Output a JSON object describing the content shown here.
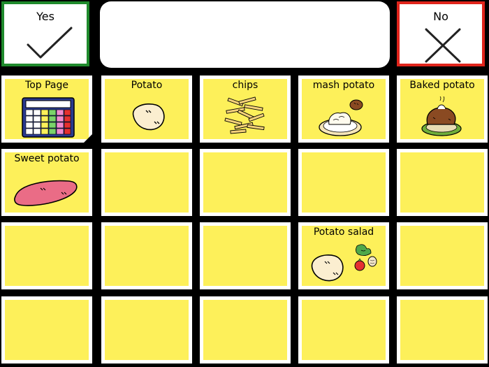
{
  "yes_button": {
    "label": "Yes"
  },
  "no_button": {
    "label": "No"
  },
  "message_bar": {
    "text": ""
  },
  "grid": {
    "top_page": "Top Page",
    "potato": "Potato",
    "chips": "chips",
    "mash_potato": "mash potato",
    "baked_potato": "Baked potato",
    "sweet_potato": "Sweet potato",
    "potato_salad": "Potato salad"
  },
  "colors": {
    "cell_fill": "#fdf05a",
    "yes_border": "#1f8a2c",
    "no_border": "#e0241b"
  }
}
